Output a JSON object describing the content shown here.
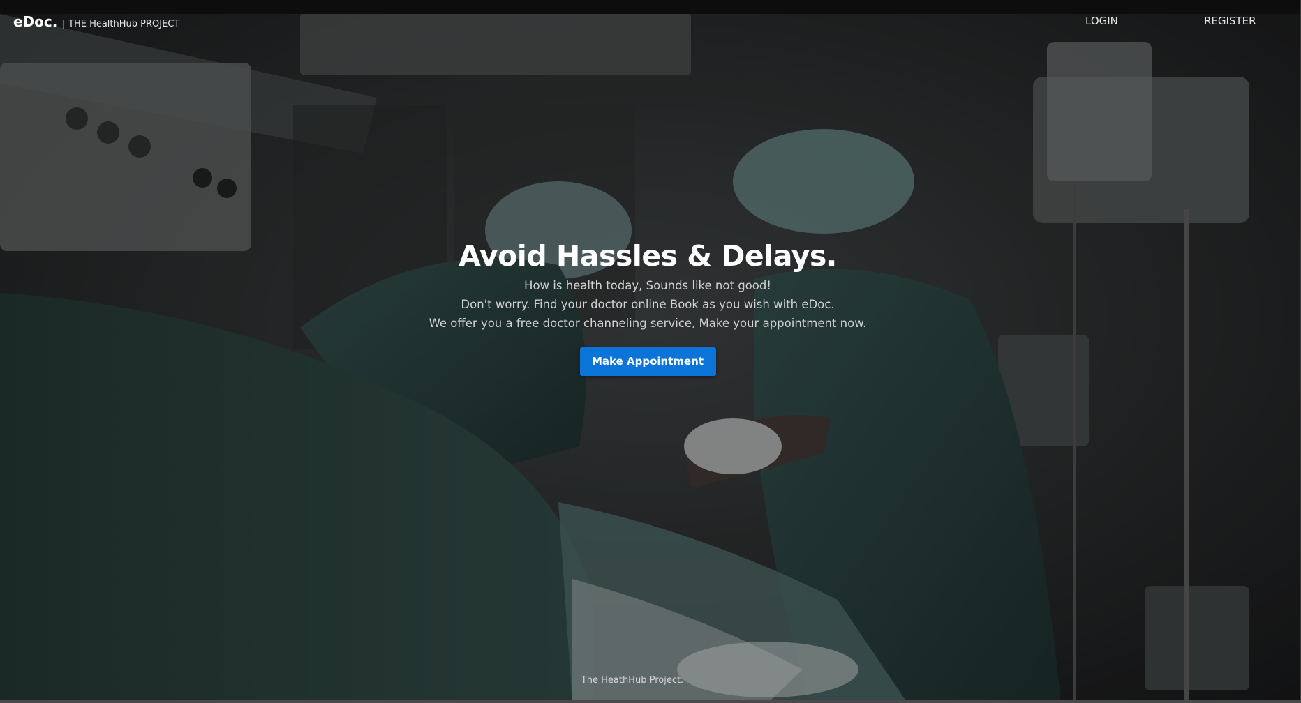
{
  "header": {
    "brand_name": "eDoc.",
    "brand_separator": "|",
    "brand_tagline": "THE HealthHub PROJECT",
    "nav": {
      "login_label": "LOGIN",
      "register_label": "REGISTER"
    }
  },
  "hero": {
    "background_image": "operating-room-surgeons-photo",
    "title": "Avoid Hassles & Delays.",
    "lines": [
      "How is health today, Sounds like not good!",
      "Don't worry. Find your doctor online Book as you wish with eDoc.",
      "We offer you a free doctor channeling service, Make your appointment now."
    ],
    "cta_label": "Make Appointment"
  },
  "footer": {
    "text": "The HeathHub Project."
  },
  "colors": {
    "accent": "#0a74d8",
    "text_primary": "#ffffff",
    "text_secondary": "#d2d2d2"
  }
}
